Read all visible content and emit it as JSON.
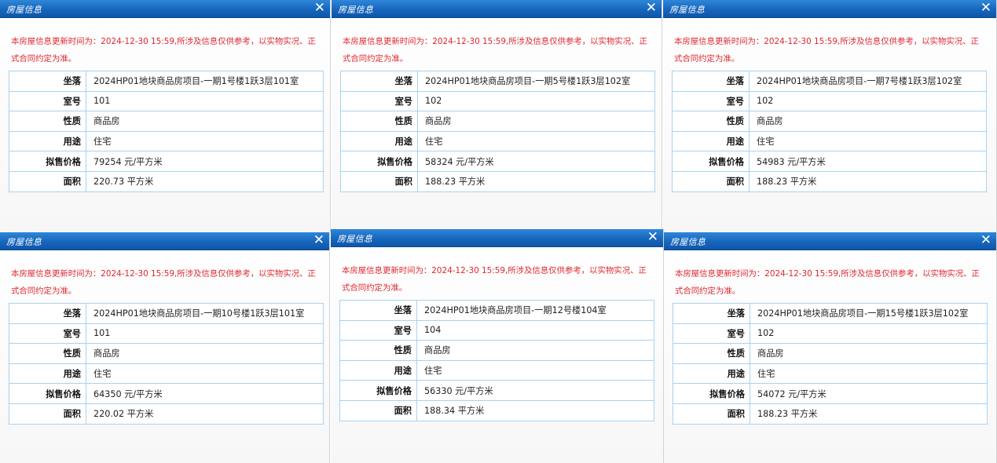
{
  "window_title": "房屋信息",
  "close_glyph": "✕",
  "notice": "本房屋信息更新时间为：2024-12-30 15:59,所涉及信息仅供参考，以实物实况、正式合同约定为准。",
  "labels": {
    "location": "坐落",
    "room": "室号",
    "nature": "性质",
    "usage": "用途",
    "price": "拟售价格",
    "area": "面积"
  },
  "panels": [
    {
      "location": "2024HP01地块商品房项目-一期1号楼1跃3层101室",
      "room": "101",
      "nature": "商品房",
      "usage": "住宅",
      "price": "79254 元/平方米",
      "area": "220.73 平方米"
    },
    {
      "location": "2024HP01地块商品房项目-一期5号楼1跃3层102室",
      "room": "102",
      "nature": "商品房",
      "usage": "住宅",
      "price": "58324 元/平方米",
      "area": "188.23 平方米"
    },
    {
      "location": "2024HP01地块商品房项目-一期7号楼1跃3层102室",
      "room": "102",
      "nature": "商品房",
      "usage": "住宅",
      "price": "54983 元/平方米",
      "area": "188.23 平方米"
    },
    {
      "location": "2024HP01地块商品房项目-一期10号楼1跃3层101室",
      "room": "101",
      "nature": "商品房",
      "usage": "住宅",
      "price": "64350 元/平方米",
      "area": "220.02 平方米"
    },
    {
      "location": "2024HP01地块商品房项目-一期12号楼104室",
      "room": "104",
      "nature": "商品房",
      "usage": "住宅",
      "price": "56330 元/平方米",
      "area": "188.34 平方米"
    },
    {
      "location": "2024HP01地块商品房项目-一期15号楼1跃3层102室",
      "room": "102",
      "nature": "商品房",
      "usage": "住宅",
      "price": "54072 元/平方米",
      "area": "188.23 平方米"
    }
  ]
}
